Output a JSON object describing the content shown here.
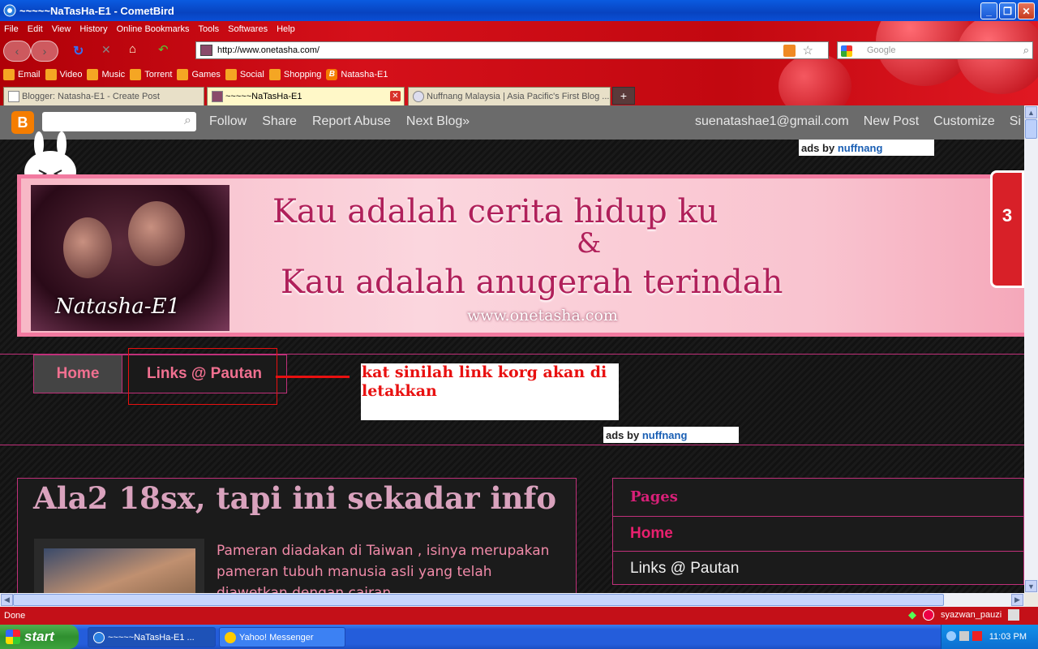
{
  "window": {
    "title": "~~~~~NaTasHa-E1 - CometBird",
    "buttons": [
      "_",
      "❐",
      "✕"
    ]
  },
  "menu": [
    "File",
    "Edit",
    "View",
    "History",
    "Online Bookmarks",
    "Tools",
    "Softwares",
    "Help"
  ],
  "navigation": {
    "url": "http://www.onetasha.com/",
    "search_placeholder": "Google"
  },
  "bookmarks": [
    "Email",
    "Video",
    "Music",
    "Torrent",
    "Games",
    "Social",
    "Shopping",
    "Natasha-E1"
  ],
  "tabs": [
    {
      "label": "Blogger: Natasha-E1 - Create Post",
      "active": false
    },
    {
      "label": "~~~~~NaTasHa-E1",
      "active": true
    },
    {
      "label": "Nuffnang Malaysia | Asia Pacific's First Blog ...",
      "active": false
    }
  ],
  "blogger_bar": {
    "logo": "B",
    "links": [
      "Follow",
      "Share",
      "Report Abuse",
      "Next Blog»"
    ],
    "email": "suenatashae1@gmail.com",
    "right_links": [
      "New Post",
      "Customize",
      "Si"
    ]
  },
  "ads": {
    "prefix": "ads by",
    "brand": "nuffnang"
  },
  "banner": {
    "line1": "Kau adalah cerita hidup ku",
    "amp": "&",
    "line2": "Kau adalah anugerah terindah",
    "url": "www.onetasha.com",
    "photo_caption": "Natasha-E1"
  },
  "side_tab": {
    "text": "3"
  },
  "page_nav": {
    "home": "Home",
    "links": "Links @ Pautan"
  },
  "annotation": {
    "note": "kat sinilah link korg akan di letakkan"
  },
  "post": {
    "title": "Ala2 18sx, tapi ini sekadar info",
    "body": "Pameran diadakan di Taiwan , isinya merupakan pameran tubuh manusia asli yang telah diawetkan dengan cairan"
  },
  "sidebar": {
    "title": "Pages",
    "items": [
      "Home",
      "Links @ Pautan"
    ]
  },
  "status": {
    "text": "Done",
    "user": "syazwan_pauzi"
  },
  "taskbar": {
    "start": "start",
    "items": [
      "~~~~~NaTasHa-E1 ...",
      "Yahoo! Messenger"
    ],
    "clock": "11:03 PM"
  },
  "colors": {
    "chrome_red": "#c41018",
    "accent_pink": "#c0307a",
    "nav_text": "#f07090",
    "annotation_red": "#e81010"
  }
}
